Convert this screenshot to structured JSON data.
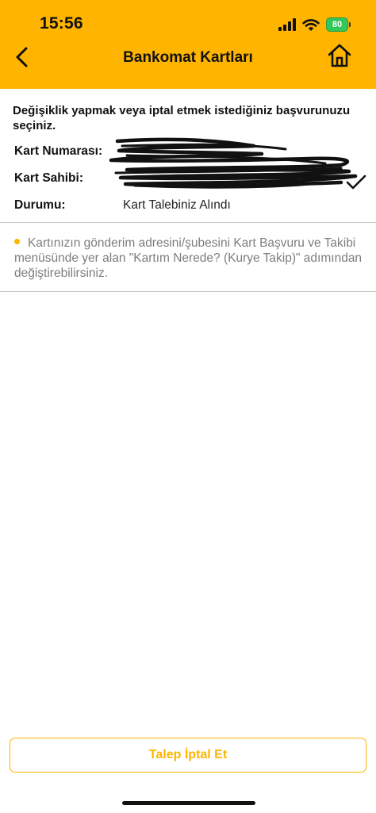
{
  "status_bar": {
    "time": "15:56",
    "battery": "80"
  },
  "header": {
    "title": "Bankomat Kartları"
  },
  "instruction": "Değişiklik yapmak veya iptal etmek istediğiniz başvurunuzu seçiniz.",
  "card": {
    "number_label": "Kart Numarası:",
    "holder_label": "Kart Sahibi:",
    "status_label": "Durumu:",
    "status_value": "Kart Talebiniz Alındı",
    "selected": true
  },
  "info_text": "Kartınızın gönderim adresini/şubesini Kart Başvuru ve Takibi menüsünde yer alan \"Kartım Nerede? (Kurye Takip)\" adımından değiştirebilirsiniz.",
  "buttons": {
    "cancel_label": "Talep İptal Et"
  },
  "colors": {
    "accent": "#ffb400",
    "info_text": "#7d7d7d",
    "battery_green": "#31c759"
  },
  "icons": {
    "back": "chevron-left-icon",
    "home": "home-icon",
    "check": "checkmark-icon",
    "signal": "cellular-signal-icon",
    "wifi": "wifi-icon",
    "battery": "battery-icon"
  }
}
